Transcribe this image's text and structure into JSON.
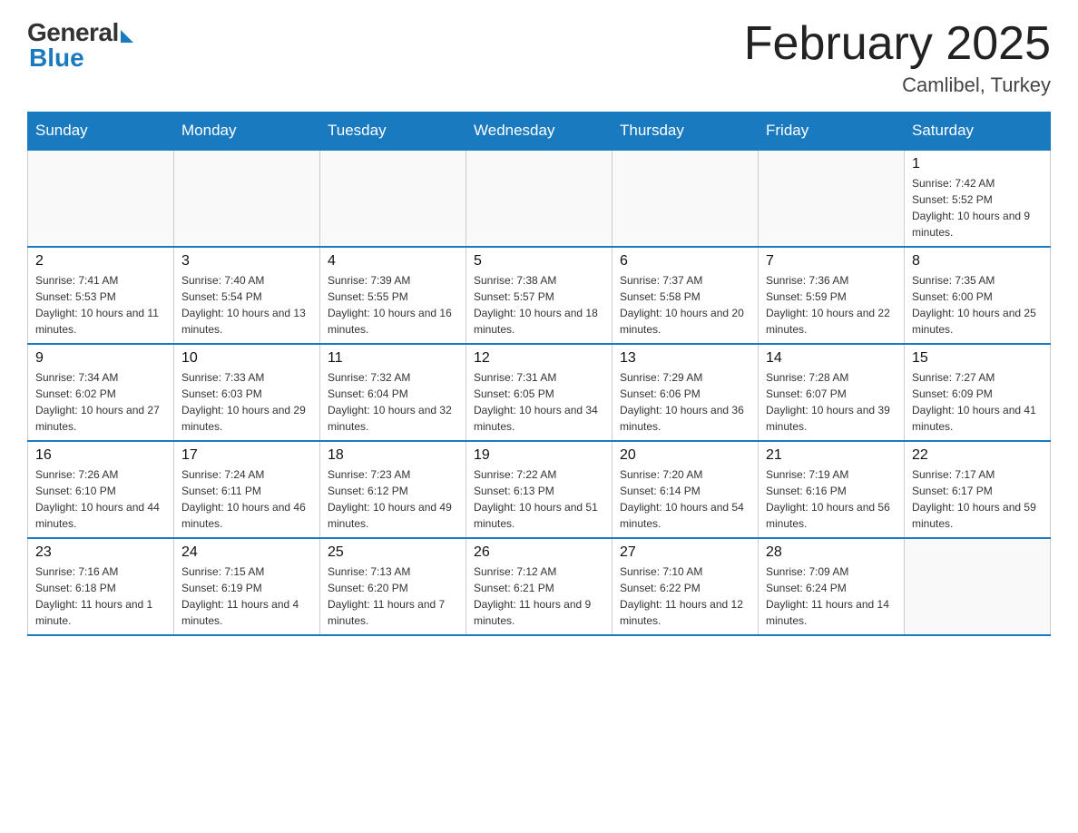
{
  "header": {
    "logo_general": "General",
    "logo_blue": "Blue",
    "month_title": "February 2025",
    "location": "Camlibel, Turkey"
  },
  "days_of_week": [
    "Sunday",
    "Monday",
    "Tuesday",
    "Wednesday",
    "Thursday",
    "Friday",
    "Saturday"
  ],
  "weeks": [
    [
      {
        "day": "",
        "info": ""
      },
      {
        "day": "",
        "info": ""
      },
      {
        "day": "",
        "info": ""
      },
      {
        "day": "",
        "info": ""
      },
      {
        "day": "",
        "info": ""
      },
      {
        "day": "",
        "info": ""
      },
      {
        "day": "1",
        "info": "Sunrise: 7:42 AM\nSunset: 5:52 PM\nDaylight: 10 hours and 9 minutes."
      }
    ],
    [
      {
        "day": "2",
        "info": "Sunrise: 7:41 AM\nSunset: 5:53 PM\nDaylight: 10 hours and 11 minutes."
      },
      {
        "day": "3",
        "info": "Sunrise: 7:40 AM\nSunset: 5:54 PM\nDaylight: 10 hours and 13 minutes."
      },
      {
        "day": "4",
        "info": "Sunrise: 7:39 AM\nSunset: 5:55 PM\nDaylight: 10 hours and 16 minutes."
      },
      {
        "day": "5",
        "info": "Sunrise: 7:38 AM\nSunset: 5:57 PM\nDaylight: 10 hours and 18 minutes."
      },
      {
        "day": "6",
        "info": "Sunrise: 7:37 AM\nSunset: 5:58 PM\nDaylight: 10 hours and 20 minutes."
      },
      {
        "day": "7",
        "info": "Sunrise: 7:36 AM\nSunset: 5:59 PM\nDaylight: 10 hours and 22 minutes."
      },
      {
        "day": "8",
        "info": "Sunrise: 7:35 AM\nSunset: 6:00 PM\nDaylight: 10 hours and 25 minutes."
      }
    ],
    [
      {
        "day": "9",
        "info": "Sunrise: 7:34 AM\nSunset: 6:02 PM\nDaylight: 10 hours and 27 minutes."
      },
      {
        "day": "10",
        "info": "Sunrise: 7:33 AM\nSunset: 6:03 PM\nDaylight: 10 hours and 29 minutes."
      },
      {
        "day": "11",
        "info": "Sunrise: 7:32 AM\nSunset: 6:04 PM\nDaylight: 10 hours and 32 minutes."
      },
      {
        "day": "12",
        "info": "Sunrise: 7:31 AM\nSunset: 6:05 PM\nDaylight: 10 hours and 34 minutes."
      },
      {
        "day": "13",
        "info": "Sunrise: 7:29 AM\nSunset: 6:06 PM\nDaylight: 10 hours and 36 minutes."
      },
      {
        "day": "14",
        "info": "Sunrise: 7:28 AM\nSunset: 6:07 PM\nDaylight: 10 hours and 39 minutes."
      },
      {
        "day": "15",
        "info": "Sunrise: 7:27 AM\nSunset: 6:09 PM\nDaylight: 10 hours and 41 minutes."
      }
    ],
    [
      {
        "day": "16",
        "info": "Sunrise: 7:26 AM\nSunset: 6:10 PM\nDaylight: 10 hours and 44 minutes."
      },
      {
        "day": "17",
        "info": "Sunrise: 7:24 AM\nSunset: 6:11 PM\nDaylight: 10 hours and 46 minutes."
      },
      {
        "day": "18",
        "info": "Sunrise: 7:23 AM\nSunset: 6:12 PM\nDaylight: 10 hours and 49 minutes."
      },
      {
        "day": "19",
        "info": "Sunrise: 7:22 AM\nSunset: 6:13 PM\nDaylight: 10 hours and 51 minutes."
      },
      {
        "day": "20",
        "info": "Sunrise: 7:20 AM\nSunset: 6:14 PM\nDaylight: 10 hours and 54 minutes."
      },
      {
        "day": "21",
        "info": "Sunrise: 7:19 AM\nSunset: 6:16 PM\nDaylight: 10 hours and 56 minutes."
      },
      {
        "day": "22",
        "info": "Sunrise: 7:17 AM\nSunset: 6:17 PM\nDaylight: 10 hours and 59 minutes."
      }
    ],
    [
      {
        "day": "23",
        "info": "Sunrise: 7:16 AM\nSunset: 6:18 PM\nDaylight: 11 hours and 1 minute."
      },
      {
        "day": "24",
        "info": "Sunrise: 7:15 AM\nSunset: 6:19 PM\nDaylight: 11 hours and 4 minutes."
      },
      {
        "day": "25",
        "info": "Sunrise: 7:13 AM\nSunset: 6:20 PM\nDaylight: 11 hours and 7 minutes."
      },
      {
        "day": "26",
        "info": "Sunrise: 7:12 AM\nSunset: 6:21 PM\nDaylight: 11 hours and 9 minutes."
      },
      {
        "day": "27",
        "info": "Sunrise: 7:10 AM\nSunset: 6:22 PM\nDaylight: 11 hours and 12 minutes."
      },
      {
        "day": "28",
        "info": "Sunrise: 7:09 AM\nSunset: 6:24 PM\nDaylight: 11 hours and 14 minutes."
      },
      {
        "day": "",
        "info": ""
      }
    ]
  ]
}
